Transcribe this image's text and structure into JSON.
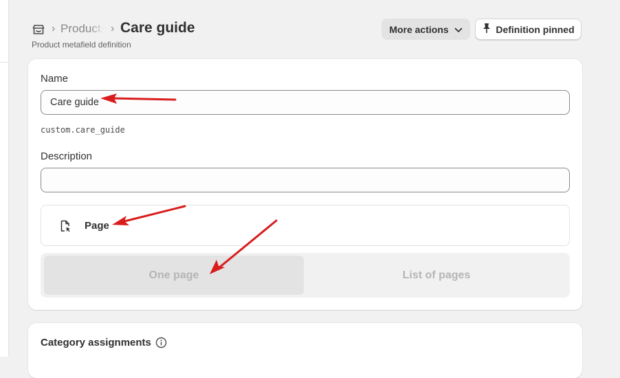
{
  "breadcrumb": {
    "parent_icon": "store-icon",
    "separator": "›",
    "parent_label": "Products",
    "current_title": "Care guide",
    "subtitle": "Product metafield definition"
  },
  "header_actions": {
    "more_actions_label": "More actions",
    "more_actions_icon": "chevron-down-icon",
    "pinned_label": "Definition pinned",
    "pinned_icon": "pin-icon"
  },
  "form": {
    "name_label": "Name",
    "name_value": "Care guide",
    "namespace_key": "custom.care_guide",
    "description_label": "Description",
    "description_value": "",
    "type": {
      "icon": "page-reference-icon",
      "label": "Page"
    },
    "reference_options": [
      {
        "label": "One page",
        "selected": true
      },
      {
        "label": "List of pages",
        "selected": false
      }
    ]
  },
  "category_section": {
    "title": "Category assignments",
    "icon": "info-icon"
  },
  "colors": {
    "annotation_arrow": "#d91c1c",
    "background": "#f1f1f1",
    "card": "#ffffff",
    "text_primary": "#303030",
    "text_muted": "#8a8a8a",
    "segment_disabled_text": "#b5b5b5"
  }
}
